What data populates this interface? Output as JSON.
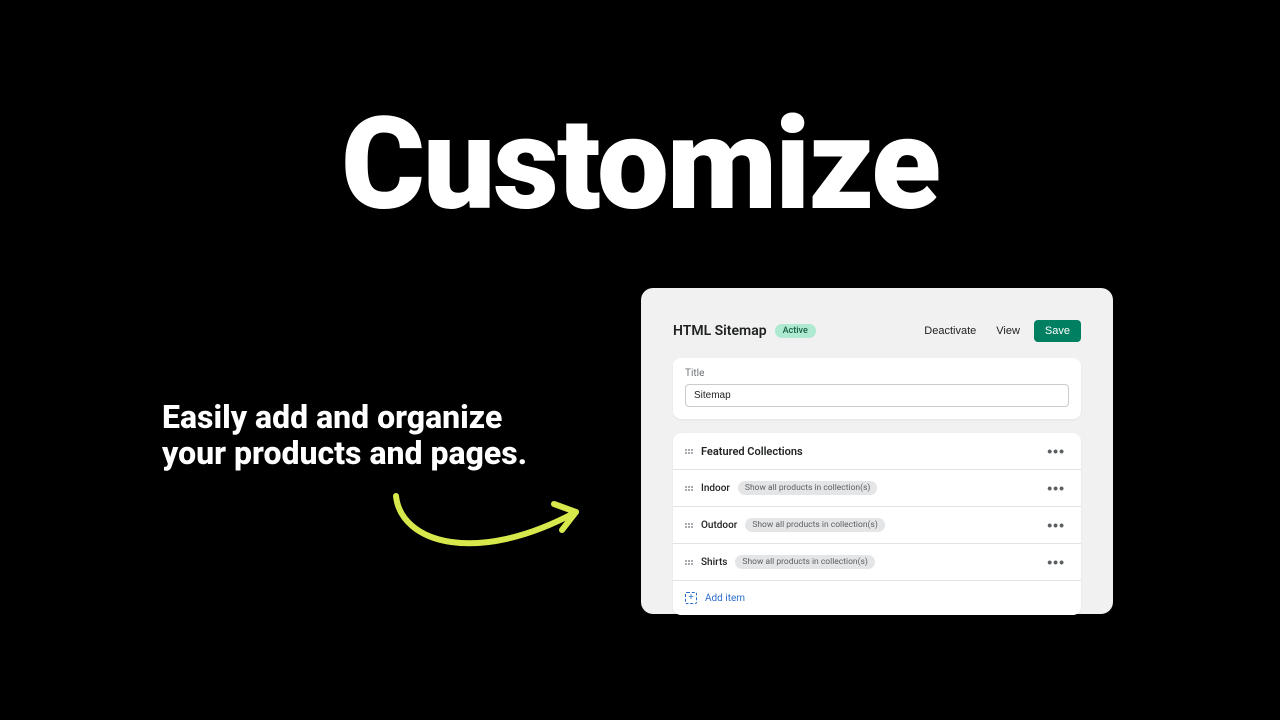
{
  "hero": {
    "headline": "Customize",
    "tagline": "Easily add and organize your products and pages."
  },
  "panel": {
    "title": "HTML Sitemap",
    "badge": "Active",
    "buttons": {
      "deactivate": "Deactivate",
      "view": "View",
      "save": "Save"
    },
    "field": {
      "label": "Title",
      "value": "Sitemap"
    },
    "items": [
      {
        "label": "Featured Collections",
        "pill": null
      },
      {
        "label": "Indoor",
        "pill": "Show all products in collection(s)"
      },
      {
        "label": "Outdoor",
        "pill": "Show all products in collection(s)"
      },
      {
        "label": "Shirts",
        "pill": "Show all products in collection(s)"
      }
    ],
    "add_label": "Add item"
  }
}
